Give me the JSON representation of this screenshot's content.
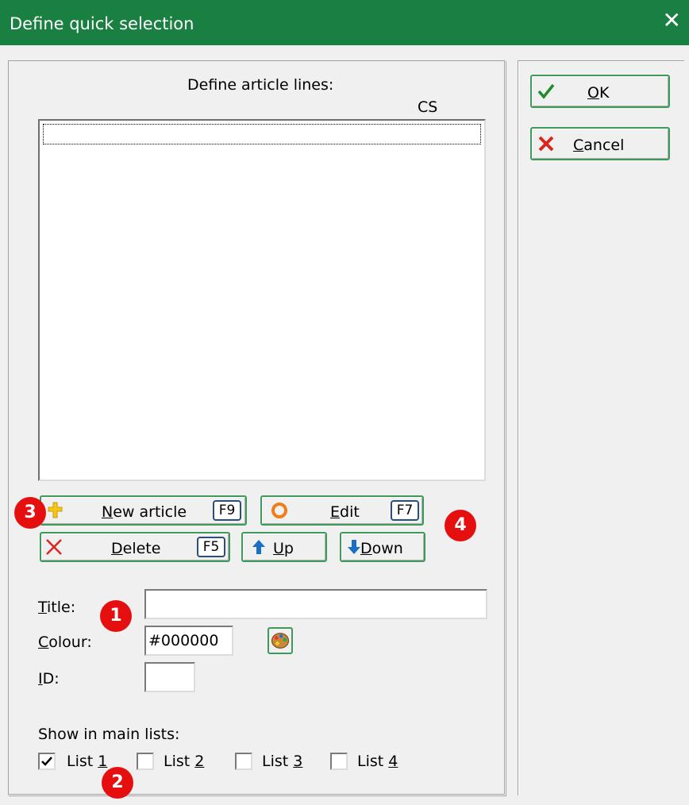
{
  "window": {
    "title": "Define quick selection"
  },
  "list": {
    "caption": "Define article lines:",
    "column_header": "CS",
    "items": []
  },
  "buttons": {
    "new_article": {
      "label": "New article",
      "underline": "N",
      "rest": "ew article",
      "key": "F9"
    },
    "edit": {
      "label": "Edit",
      "underline": "E",
      "rest": "dit",
      "key": "F7"
    },
    "delete": {
      "label": "Delete",
      "underline": "D",
      "rest": "elete",
      "key": "F5"
    },
    "up": {
      "label": "Up",
      "underline": "U",
      "rest": "p"
    },
    "down": {
      "label": "Down",
      "underline": "D",
      "rest": "own"
    },
    "ok": {
      "label": "OK",
      "underline": "O",
      "rest": "K"
    },
    "cancel": {
      "label": "Cancel",
      "underline": "C",
      "rest": "ancel"
    }
  },
  "fields": {
    "title": {
      "label_u": "T",
      "label_rest": "itle:",
      "value": ""
    },
    "colour": {
      "label_u": "C",
      "label_rest": "olour:",
      "value": "#000000"
    },
    "id": {
      "label_u": "I",
      "label_rest": "D:",
      "value": ""
    }
  },
  "show_in_lists": {
    "caption": "Show in main lists:",
    "items": [
      {
        "label_pre": "List ",
        "label_u": "1",
        "checked": true
      },
      {
        "label_pre": "List ",
        "label_u": "2",
        "checked": false
      },
      {
        "label_pre": "List ",
        "label_u": "3",
        "checked": false
      },
      {
        "label_pre": "List ",
        "label_u": "4",
        "checked": false
      }
    ]
  },
  "callouts": [
    "1",
    "2",
    "3",
    "4"
  ],
  "colors": {
    "titlebar": "#1a8041",
    "accent_border": "#3e9a5a",
    "badge": "#e60f0f",
    "check_green": "#1f8a2e",
    "cancel_red": "#d9261c"
  }
}
